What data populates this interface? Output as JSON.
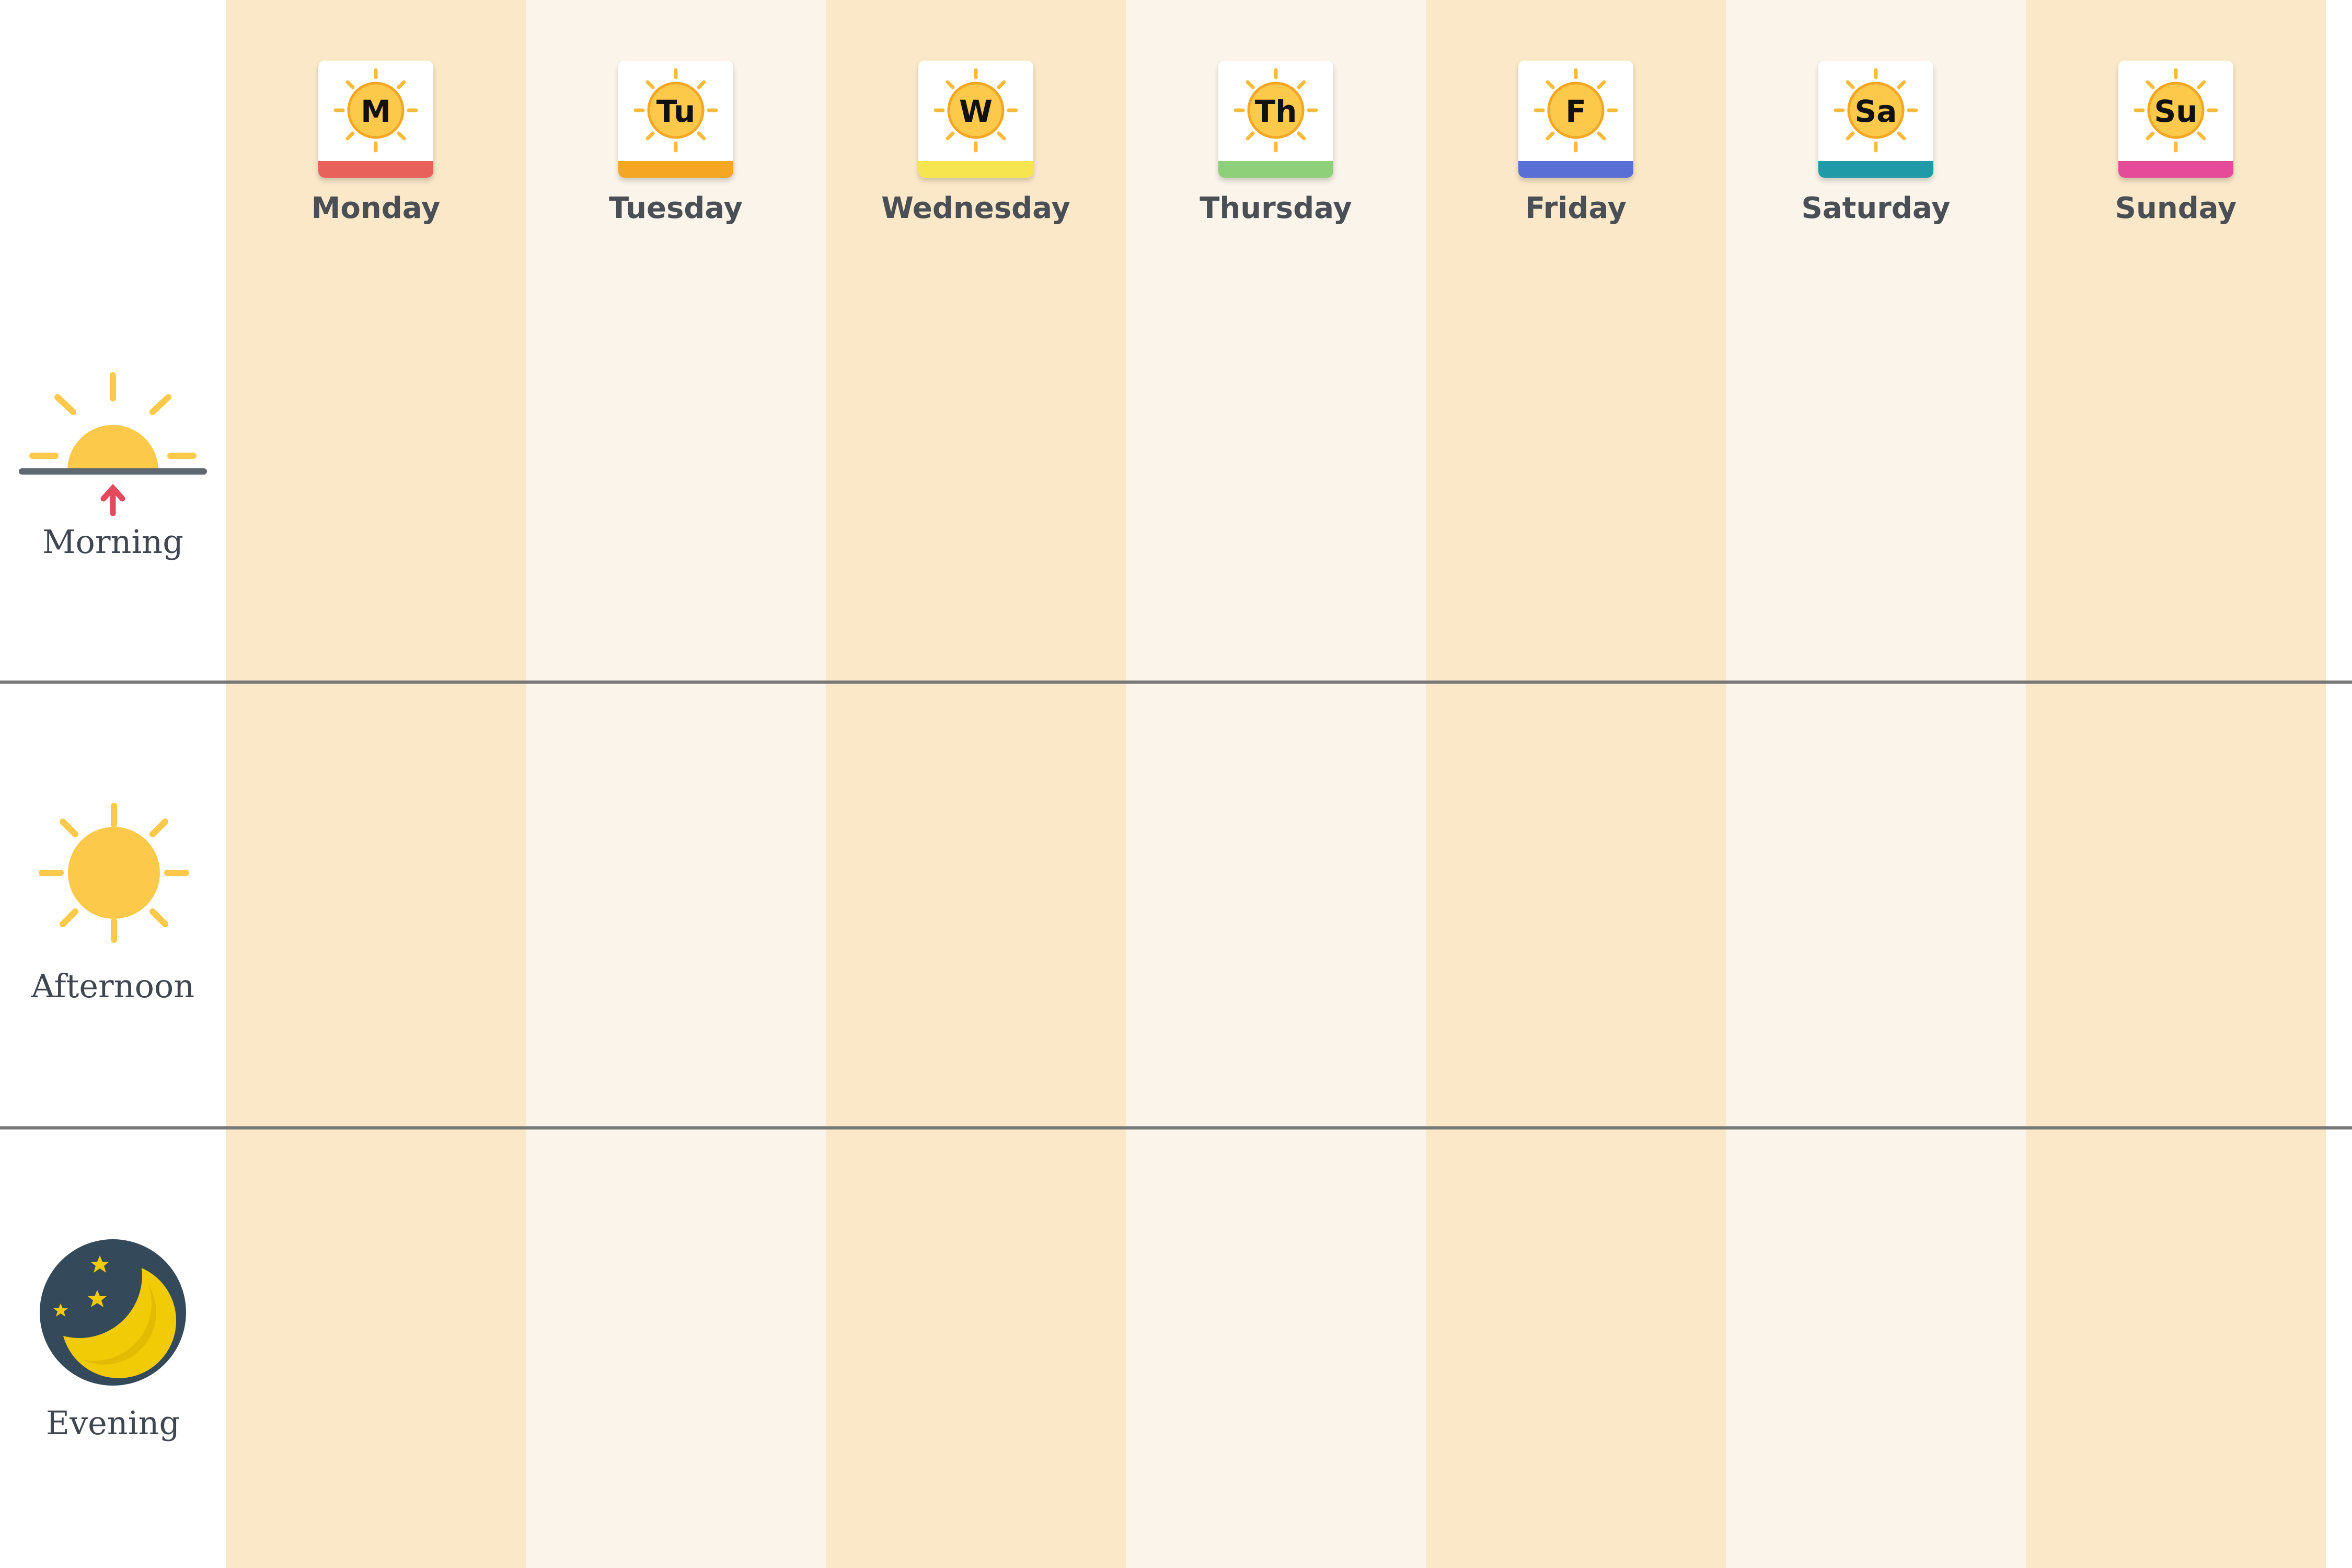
{
  "days": [
    {
      "abbr": "M",
      "name": "Monday",
      "color": "#e8615a"
    },
    {
      "abbr": "Tu",
      "name": "Tuesday",
      "color": "#f5a623"
    },
    {
      "abbr": "W",
      "name": "Wednesday",
      "color": "#f6e54e"
    },
    {
      "abbr": "Th",
      "name": "Thursday",
      "color": "#8ed07a"
    },
    {
      "abbr": "F",
      "name": "Friday",
      "color": "#5a6fd6"
    },
    {
      "abbr": "Sa",
      "name": "Saturday",
      "color": "#1f9aa6"
    },
    {
      "abbr": "Su",
      "name": "Sunday",
      "color": "#e64b9a"
    }
  ],
  "periods": [
    {
      "label": "Morning",
      "icon": "sunrise-icon"
    },
    {
      "label": "Afternoon",
      "icon": "sun-icon"
    },
    {
      "label": "Evening",
      "icon": "moon-icon"
    }
  ],
  "colors": {
    "column_dark": "#fbe8c8",
    "column_light": "#faf4ea",
    "divider": "#787878",
    "sun": "#fdc94a",
    "sun_rays": "#f9bb3a",
    "moon_bg": "#34495a",
    "moon": "#f2cb07",
    "arrow": "#e4495c"
  }
}
